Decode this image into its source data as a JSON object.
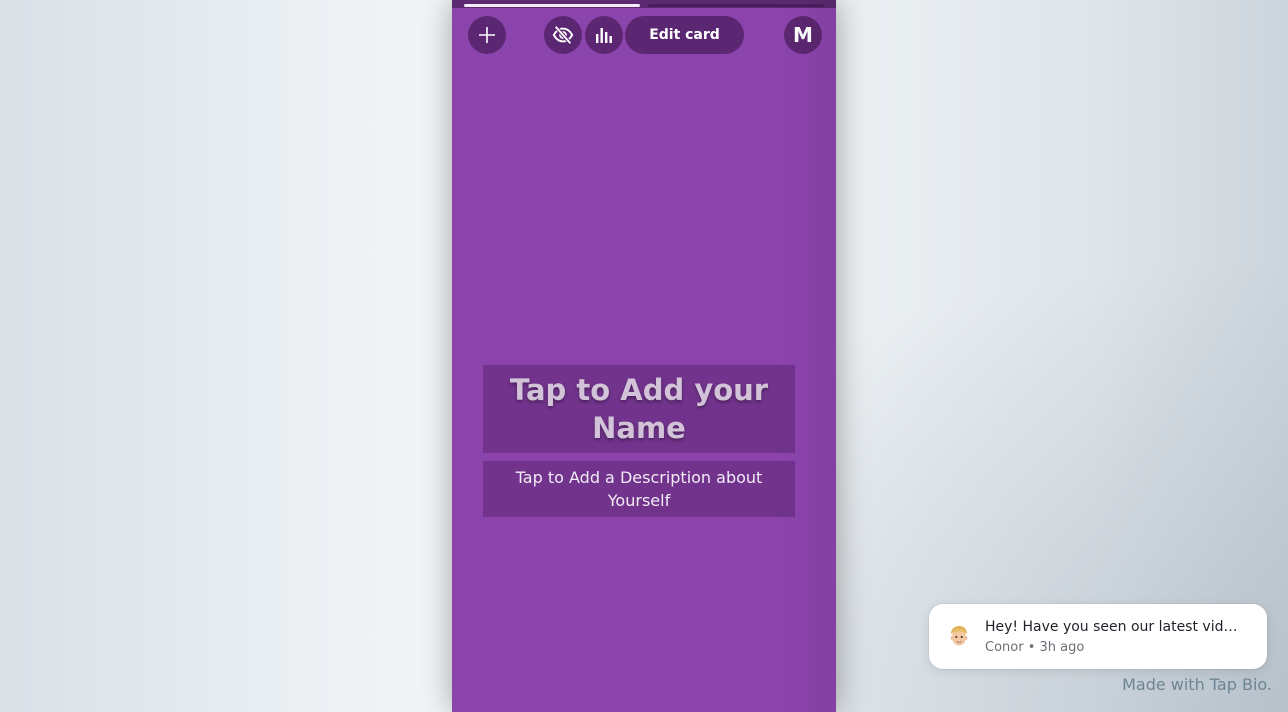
{
  "colors": {
    "card_background": "#8c44ad",
    "button_background": "#5c2772",
    "page_background": "#eef2f5"
  },
  "story_progress": {
    "segments": 2,
    "active_segment": 1
  },
  "toolbar": {
    "add_icon": "plus-icon",
    "hide_icon": "eye-slash-icon",
    "stats_icon": "bar-chart-icon",
    "edit_label": "Edit card",
    "avatar_initial": "M"
  },
  "profile": {
    "name_placeholder": "Tap to Add your Name",
    "description_placeholder": "Tap to Add a Description about Yourself"
  },
  "notification": {
    "avatar_icon": "memoji-avatar-icon",
    "message": "Hey! Have you seen our latest vid…",
    "sender": "Conor",
    "separator": "•",
    "time": "3h ago"
  },
  "footer": {
    "made_with": "Made with Tap Bio."
  }
}
